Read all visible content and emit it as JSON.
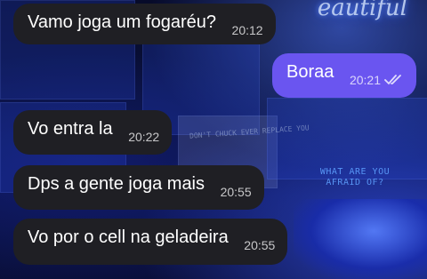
{
  "background": {
    "neon_sign": "eautiful",
    "sign_text": "WHAT ARE YOU AFRAID OF?",
    "wall_text": "DON'T CHUCK EVER REPLACE YOU",
    "accent": "#2f4dff"
  },
  "messages": [
    {
      "direction": "incoming",
      "text": "Vamo joga um fogaréu?",
      "time": "20:12"
    },
    {
      "direction": "outgoing",
      "text": "Boraa",
      "time": "20:21",
      "status_icon": "double-check-icon"
    },
    {
      "direction": "incoming",
      "text": "Vo entra la",
      "time": "20:22"
    },
    {
      "direction": "incoming",
      "text": "Dps a gente joga  mais",
      "time": "20:55"
    },
    {
      "direction": "incoming",
      "text": "Vo por o cell na geladeira",
      "time": "20:55"
    }
  ],
  "colors": {
    "incoming_bubble": "#1f1f24",
    "outgoing_bubble": "#6a55f0"
  }
}
